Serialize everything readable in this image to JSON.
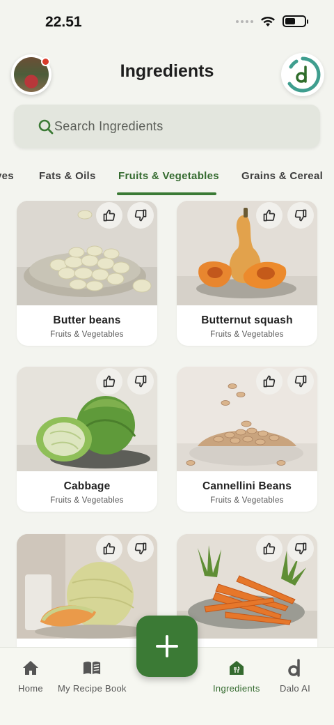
{
  "status_bar": {
    "time": "22.51",
    "battery_level": 0.55
  },
  "header": {
    "title": "Ingredients"
  },
  "search": {
    "placeholder": "Search Ingredients"
  },
  "tabs": [
    {
      "label": "ves"
    },
    {
      "label": "Fats & Oils"
    },
    {
      "label": "Fruits & Vegetables",
      "active": true
    },
    {
      "label": "Grains & Cereal"
    }
  ],
  "ingredients": [
    {
      "name": "Butter beans",
      "category": "Fruits & Vegetables"
    },
    {
      "name": "Butternut squash",
      "category": "Fruits & Vegetables"
    },
    {
      "name": "Cabbage",
      "category": "Fruits & Vegetables"
    },
    {
      "name": "Cannellini Beans",
      "category": "Fruits & Vegetables"
    },
    {
      "name": "",
      "category": ""
    },
    {
      "name": "",
      "category": ""
    }
  ],
  "nav": {
    "items": [
      {
        "label": "Home",
        "icon": "home-icon"
      },
      {
        "label": "My Recipe Book",
        "icon": "book-icon"
      },
      {
        "label": "Ingredients",
        "icon": "ingredients-icon",
        "active": true
      },
      {
        "label": "Dalo AI",
        "icon": "dalo-icon"
      }
    ]
  },
  "colors": {
    "accent": "#3b7a35",
    "teal": "#3f9e8f",
    "background": "#f3f4ef",
    "notification": "#d93a2b"
  }
}
